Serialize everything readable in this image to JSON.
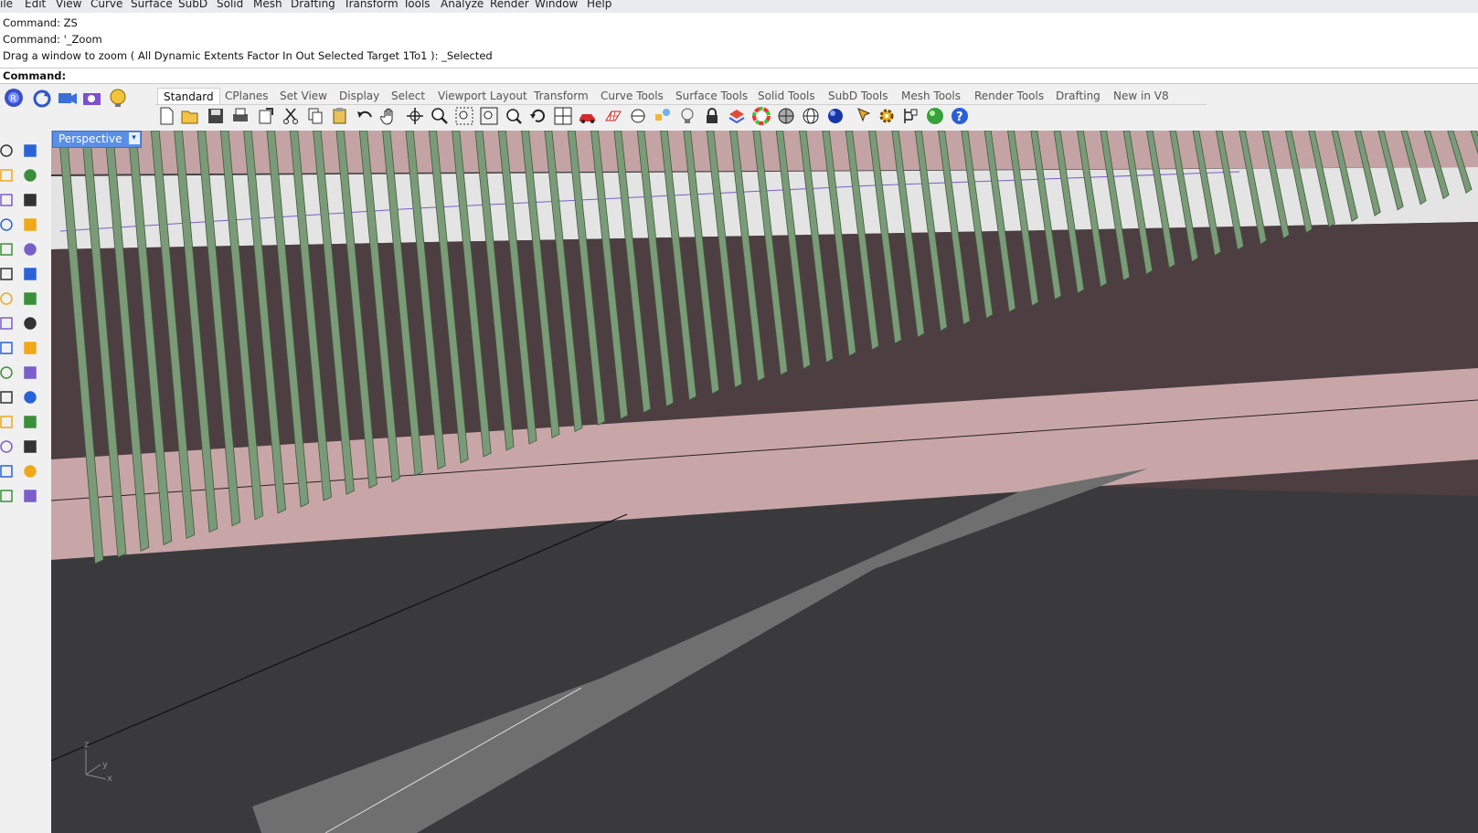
{
  "menu": [
    "ile",
    "Edit",
    "View",
    "Curve",
    "Surface",
    "SubD",
    "Solid",
    "Mesh",
    "Drafting",
    "Transform",
    "Tools",
    "Analyze",
    "Render",
    "Window",
    "Help"
  ],
  "command_history": [
    "Command: ZS",
    "Command: '_Zoom",
    "Drag a window to zoom ( All  Dynamic  Extents  Factor  In  Out  Selected  Target  1To1 ): _Selected"
  ],
  "command_prompt": "Command:",
  "quick_icons": [
    "rhino-app-icon",
    "refresh-icon",
    "camera-icon",
    "snapshot-icon",
    "light-bulb-icon"
  ],
  "tabs": [
    "Standard",
    "CPlanes",
    "Set View",
    "Display",
    "Select",
    "Viewport Layout",
    "Transform",
    "Curve Tools",
    "Surface Tools",
    "Solid Tools",
    "SubD Tools",
    "Mesh Tools",
    "Render Tools",
    "Drafting",
    "New in V8"
  ],
  "active_tab": "Standard",
  "toolbar_icons": [
    "new-file-icon",
    "open-icon",
    "save-icon",
    "print-icon",
    "export-icon",
    "cut-icon",
    "copy-icon",
    "paste-icon",
    "undo-icon",
    "pan-icon",
    "rotate-view-icon",
    "zoom-icon",
    "zoom-window-icon",
    "zoom-extents-icon",
    "zoom-selected-icon",
    "rotate-icon",
    "four-viewports-icon",
    "car-icon",
    "grid-icon",
    "cplane-icon",
    "snap-icon",
    "bulb-icon",
    "lock-icon",
    "layer-icon",
    "color-wheel-icon",
    "shaded-sphere-icon",
    "wire-sphere-icon",
    "render-sphere-icon",
    "blue-sphere-icon",
    "pointer-icon",
    "gear-icon",
    "tree-icon",
    "globe-icon",
    "help-icon"
  ],
  "viewport": {
    "name": "Perspective",
    "axis_labels": {
      "z": "z",
      "y": "y",
      "x": "x"
    },
    "colors": {
      "background": "#3a3a3d",
      "fins": "#7a9a78",
      "wall": "#c9aaaa",
      "dark_band": "#4e3e40"
    }
  }
}
